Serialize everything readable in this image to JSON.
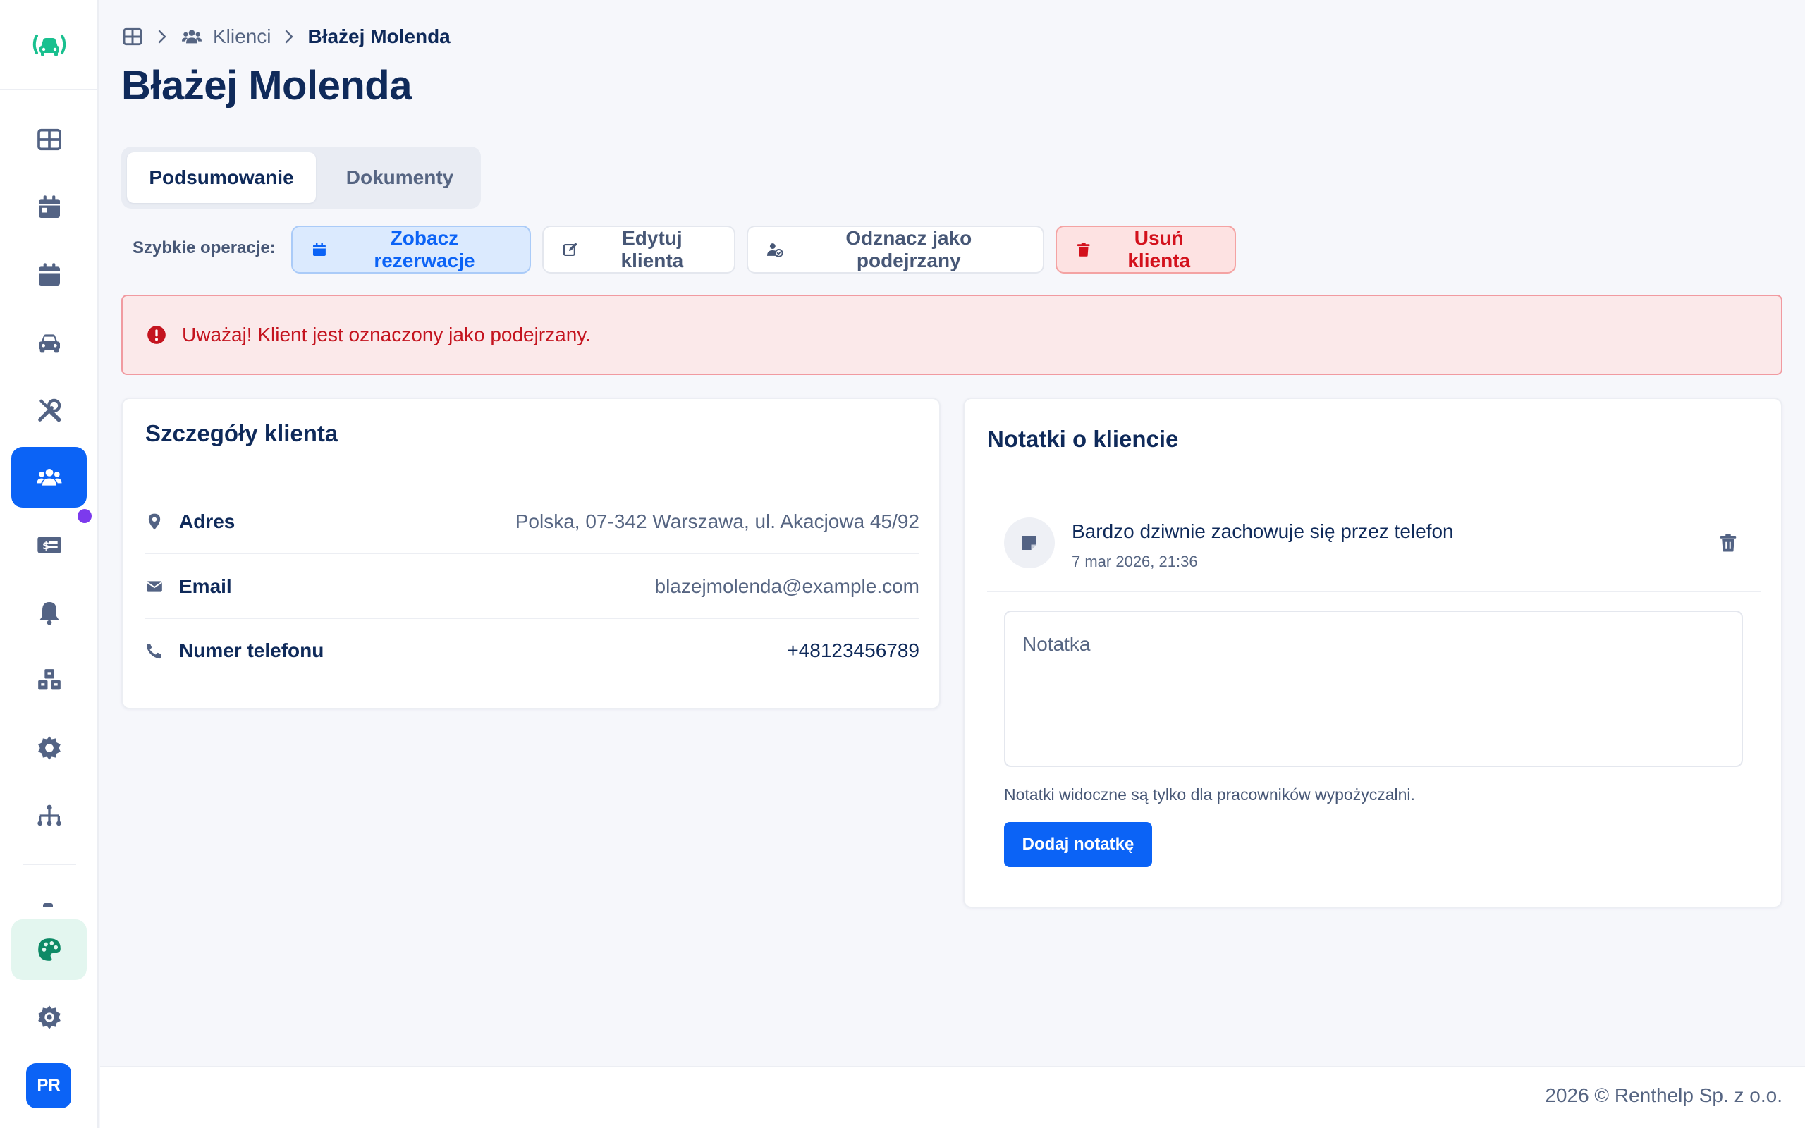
{
  "colors": {
    "accent": "#0b63f6",
    "brand_green": "#19c08f",
    "danger": "#d3111c",
    "text_primary": "#0f2a5a",
    "text_muted": "#566582",
    "violet_dot": "#7c3aed"
  },
  "sidebar": {
    "icons": [
      "dashboard-icon",
      "calendar-day-icon",
      "calendar-icon",
      "car-icon",
      "tools-icon",
      "users-icon",
      "money-card-icon",
      "bell-icon",
      "cubes-icon",
      "gear-icon",
      "sitemap-icon",
      "palette-icon",
      "cog-icon"
    ],
    "active_item": "users-icon",
    "user_initials": "PR"
  },
  "breadcrumb": {
    "link": "Klienci",
    "current": "Błażej Molenda"
  },
  "page": {
    "title": "Błażej Molenda"
  },
  "tabs": [
    {
      "label": "Podsumowanie",
      "active": true
    },
    {
      "label": "Dokumenty",
      "active": false
    }
  ],
  "quick_actions": {
    "label": "Szybkie operacje:",
    "view_reservations": "Zobacz rezerwacje",
    "edit_client": "Edytuj klienta",
    "unmark_suspicious": "Odznacz jako podejrzany",
    "delete_client": "Usuń klienta"
  },
  "alert": {
    "message": "Uważaj! Klient jest oznaczony jako podejrzany."
  },
  "details": {
    "title": "Szczegóły klienta",
    "rows": [
      {
        "label": "Adres",
        "value": "Polska, 07-342 Warszawa, ul. Akacjowa 45/92"
      },
      {
        "label": "Email",
        "value": "blazejmolenda@example.com"
      },
      {
        "label": "Numer telefonu",
        "value": "+48123456789"
      }
    ]
  },
  "notes": {
    "title": "Notatki o kliencie",
    "items": [
      {
        "text": "Bardzo dziwnie zachowuje się przez telefon",
        "date": "7 mar 2026, 21:36"
      }
    ],
    "input_placeholder": "Notatka",
    "input_value": "",
    "hint": "Notatki widoczne są tylko dla pracowników wypożyczalni.",
    "add_button": "Dodaj notatkę"
  },
  "footer": {
    "text": "2026 © Renthelp Sp. z o.o."
  }
}
